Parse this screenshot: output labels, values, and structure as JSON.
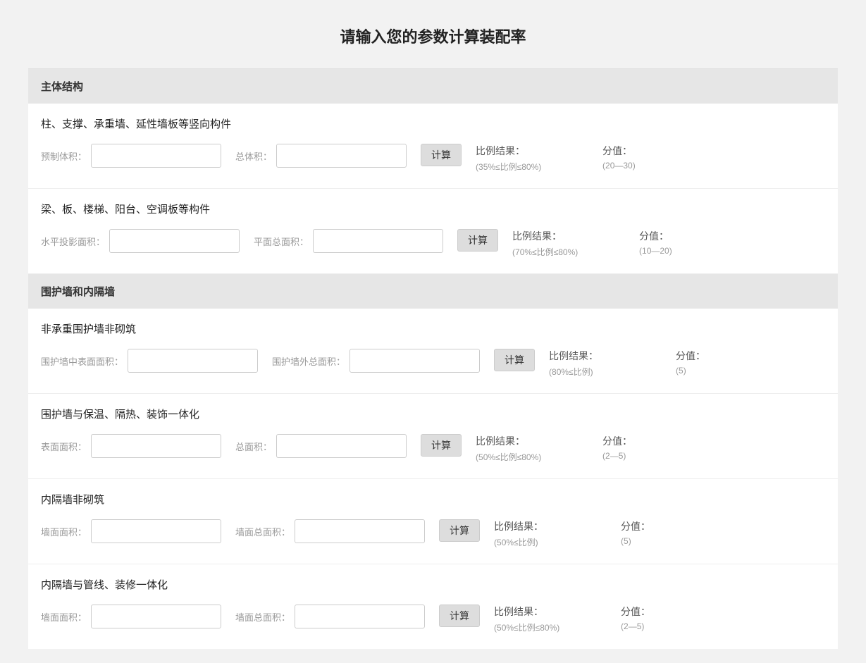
{
  "page_title": "请输入您的参数计算装配率",
  "calc_button": "计算",
  "result_label": "比例结果：",
  "score_label": "分值：",
  "sections": [
    {
      "header": "主体结构",
      "blocks": [
        {
          "title": "柱、支撑、承重墙、延性墙板等竖向构件",
          "field1_label": "预制体积：",
          "field2_label": "总体积：",
          "ratio_range": "(35%≤比例≤80%)",
          "score_range": "(20—30)"
        },
        {
          "title": "梁、板、楼梯、阳台、空调板等构件",
          "field1_label": "水平投影面积：",
          "field2_label": "平面总面积：",
          "ratio_range": "(70%≤比例≤80%)",
          "score_range": "(10—20)"
        }
      ]
    },
    {
      "header": "围护墙和内隔墙",
      "blocks": [
        {
          "title": "非承重围护墙非砌筑",
          "field1_label": "围护墙中表面面积：",
          "field2_label": "围护墙外总面积：",
          "ratio_range": "(80%≤比例)",
          "score_range": "(5)"
        },
        {
          "title": "围护墙与保温、隔热、装饰一体化",
          "field1_label": "表面面积：",
          "field2_label": "总面积：",
          "ratio_range": "(50%≤比例≤80%)",
          "score_range": "(2—5)"
        },
        {
          "title": "内隔墙非砌筑",
          "field1_label": "墙面面积：",
          "field2_label": "墙面总面积：",
          "ratio_range": "(50%≤比例)",
          "score_range": "(5)"
        },
        {
          "title": "内隔墙与管线、装修一体化",
          "field1_label": "墙面面积：",
          "field2_label": "墙面总面积：",
          "ratio_range": "(50%≤比例≤80%)",
          "score_range": "(2—5)"
        }
      ]
    }
  ]
}
